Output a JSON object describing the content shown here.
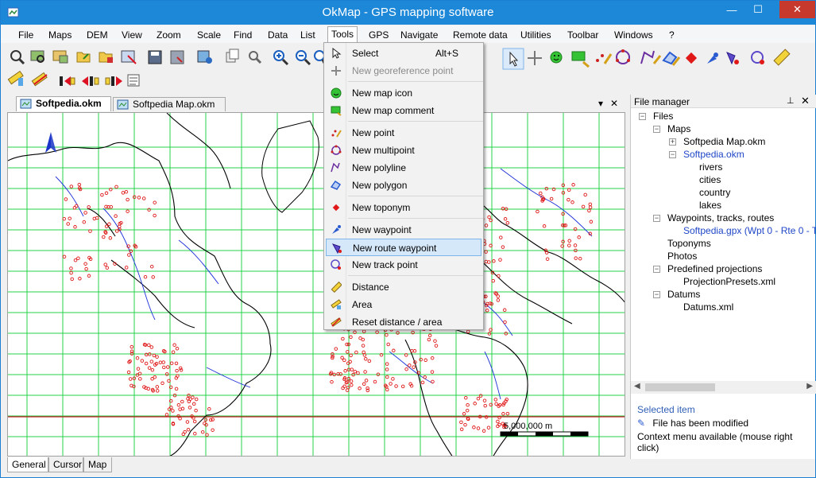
{
  "window": {
    "title": "OkMap - GPS mapping software",
    "minimize_glyph": "—",
    "maximize_glyph": "☐",
    "close_glyph": "✕"
  },
  "menu": [
    "File",
    "Maps",
    "DEM",
    "View",
    "Zoom",
    "Scale",
    "Find",
    "Data",
    "List",
    "Tools",
    "GPS",
    "Navigate",
    "Remote data",
    "Utilities",
    "Toolbar",
    "Windows",
    "?"
  ],
  "active_menu": "Tools",
  "tools_menu": [
    {
      "label": "Select",
      "shortcut": "Alt+S",
      "icon": "pointer-icon",
      "enabled": true
    },
    {
      "label": "New georeference point",
      "icon": "crosshair-icon",
      "enabled": false
    },
    {
      "separator": true
    },
    {
      "label": "New map icon",
      "icon": "smiley-icon",
      "enabled": true
    },
    {
      "label": "New map comment",
      "icon": "comment-icon",
      "enabled": true
    },
    {
      "separator": true
    },
    {
      "label": "New point",
      "icon": "point-icon",
      "enabled": true
    },
    {
      "label": "New multipoint",
      "icon": "multipoint-icon",
      "enabled": true
    },
    {
      "label": "New polyline",
      "icon": "polyline-icon",
      "enabled": true
    },
    {
      "label": "New polygon",
      "icon": "polygon-icon",
      "enabled": true
    },
    {
      "separator": true
    },
    {
      "label": "New toponym",
      "icon": "toponym-icon",
      "enabled": true
    },
    {
      "separator": true
    },
    {
      "label": "New waypoint",
      "icon": "waypoint-icon",
      "enabled": true
    },
    {
      "label": "New route waypoint",
      "icon": "route-waypoint-icon",
      "enabled": true,
      "highlighted": true
    },
    {
      "label": "New track point",
      "icon": "track-point-icon",
      "enabled": true
    },
    {
      "separator": true
    },
    {
      "label": "Distance",
      "icon": "ruler-icon",
      "enabled": true
    },
    {
      "label": "Area",
      "icon": "area-icon",
      "enabled": true
    },
    {
      "label": "Reset distance / area",
      "icon": "reset-icon",
      "enabled": true
    }
  ],
  "doc_tabs": [
    {
      "label": "Softpedia.okm",
      "active": true
    },
    {
      "label": "Softpedia Map.okm",
      "active": false
    }
  ],
  "doc_tab_controls": {
    "dropdown": "▾",
    "close": "✕"
  },
  "file_manager": {
    "title": "File manager",
    "pin_glyph": "⊥",
    "close_glyph": "✕",
    "tree": [
      {
        "label": "Files",
        "level": 0,
        "expander": "−"
      },
      {
        "label": "Maps",
        "level": 1,
        "expander": "−"
      },
      {
        "label": "Softpedia Map.okm",
        "level": 2,
        "expander": "+"
      },
      {
        "label": "Softpedia.okm",
        "level": 2,
        "expander": "−",
        "selected": true
      },
      {
        "label": "rivers",
        "level": 3
      },
      {
        "label": "cities",
        "level": 3
      },
      {
        "label": "country",
        "level": 3
      },
      {
        "label": "lakes",
        "level": 3
      },
      {
        "label": "Waypoints, tracks, routes",
        "level": 1,
        "expander": "−"
      },
      {
        "label": "Softpedia.gpx (Wpt 0 - Rte 0 - T",
        "level": 2,
        "selected": true
      },
      {
        "label": "Toponyms",
        "level": 1
      },
      {
        "label": "Photos",
        "level": 1
      },
      {
        "label": "Predefined projections",
        "level": 1,
        "expander": "−"
      },
      {
        "label": "ProjectionPresets.xml",
        "level": 2
      },
      {
        "label": "Datums",
        "level": 1,
        "expander": "−"
      },
      {
        "label": "Datums.xml",
        "level": 2
      }
    ],
    "status_title": "Selected item",
    "status_lines": [
      "File has been modified",
      "Context menu available (mouse right click)"
    ]
  },
  "map": {
    "scale_label": "5,000,000 m",
    "north_arrow": "north-arrow-icon",
    "colors": {
      "grid": "#26d34a",
      "rivers": "#1a2fd8",
      "cities": "#e01818",
      "coast": "#000000",
      "equator": "#c0181c"
    }
  },
  "bottom_tabs": [
    {
      "label": "General",
      "active": true
    },
    {
      "label": "Cursor",
      "active": false
    },
    {
      "label": "Map",
      "active": false
    }
  ],
  "toolbar_icons": [
    "open-map-icon",
    "find-map-icon",
    "open-map-file-icon",
    "open-folder-icon",
    "open-folder-red-icon",
    "map-remove-icon",
    "save-icon",
    "save-as-icon",
    "map-settings-icon",
    "hand-drag-icon",
    "copy-icon",
    "magnifier-icon",
    "zoom-in-icon",
    "zoom-out-icon",
    "zoom-fit-icon"
  ]
}
